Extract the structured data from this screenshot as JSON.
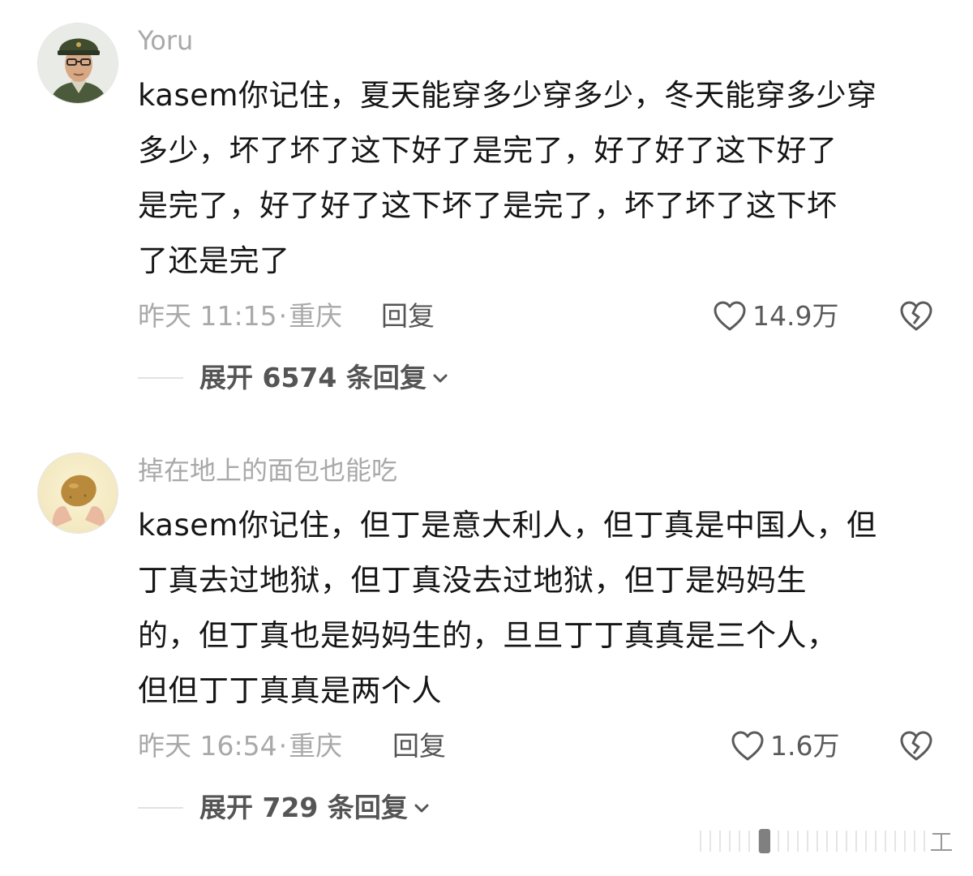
{
  "comments": [
    {
      "username": "Yoru",
      "lines": [
        "kasem你记住，夏天能穿多少穿多少，冬天能穿多少穿",
        "多少，坏了坏了这下好了是完了，好了好了这下好了",
        "是完了，好了好了这下坏了是完了，坏了坏了这下坏",
        "了还是完了"
      ],
      "time": "昨天 11:15",
      "dot": "·",
      "location": "重庆",
      "reply_label": "回复",
      "likes": "14.9万",
      "expand_label": "展开 6574 条回复",
      "avatar_icon": "soldier-avatar"
    },
    {
      "username": "掉在地上的面包也能吃",
      "lines": [
        "kasem你记住，但丁是意大利人，但丁真是中国人，但",
        "丁真去过地狱，但丁真没去过地狱，但丁是妈妈生",
        "的，但丁真也是妈妈生的，旦旦丁丁真真是三个人，",
        "但但丁丁真真是两个人"
      ],
      "time": "昨天 16:54",
      "dot": "·",
      "location": "重庆",
      "reply_label": "回复",
      "likes": "1.6万",
      "expand_label": "展开 729 条回复",
      "avatar_icon": "potato-hands-avatar"
    }
  ],
  "icons": {
    "like": "heart-outline-icon",
    "dislike": "broken-heart-icon",
    "expand": "chevron-down-icon"
  },
  "colors": {
    "text": "#161616",
    "muted": "#a9a9a9",
    "action": "#555555"
  }
}
